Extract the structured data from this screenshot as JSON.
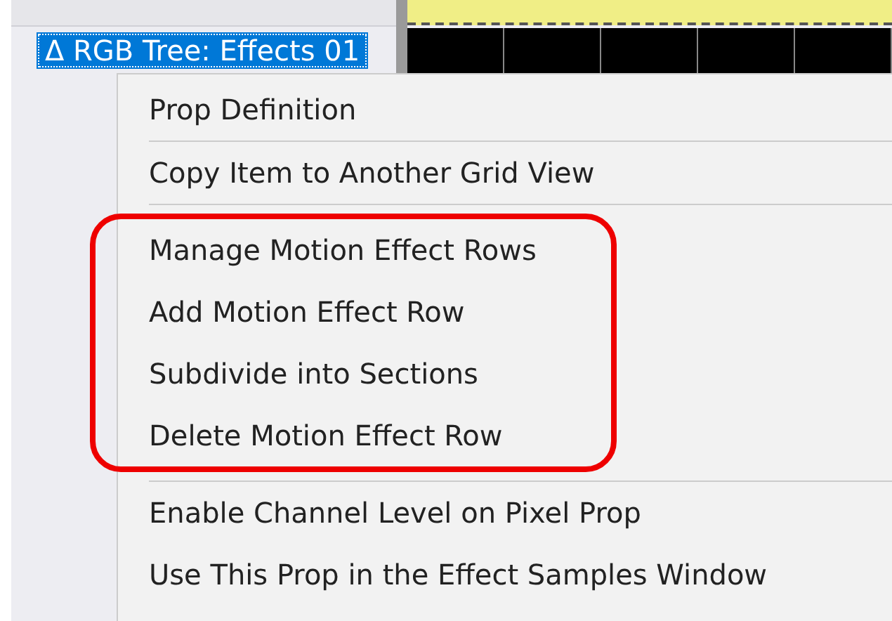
{
  "tree_item": {
    "label": "Δ RGB Tree: Effects 01",
    "selected": true
  },
  "context_menu": {
    "groups": [
      {
        "highlighted": false,
        "items": [
          "Prop Definition"
        ]
      },
      {
        "highlighted": false,
        "items": [
          "Copy Item to Another Grid View"
        ]
      },
      {
        "highlighted": true,
        "items": [
          "Manage Motion Effect Rows",
          "Add Motion Effect Row",
          "Subdivide into Sections",
          "Delete Motion Effect Row"
        ]
      },
      {
        "highlighted": false,
        "items": [
          "Enable Channel Level on Pixel Prop",
          "Use This Prop in the Effect Samples Window"
        ]
      }
    ]
  }
}
